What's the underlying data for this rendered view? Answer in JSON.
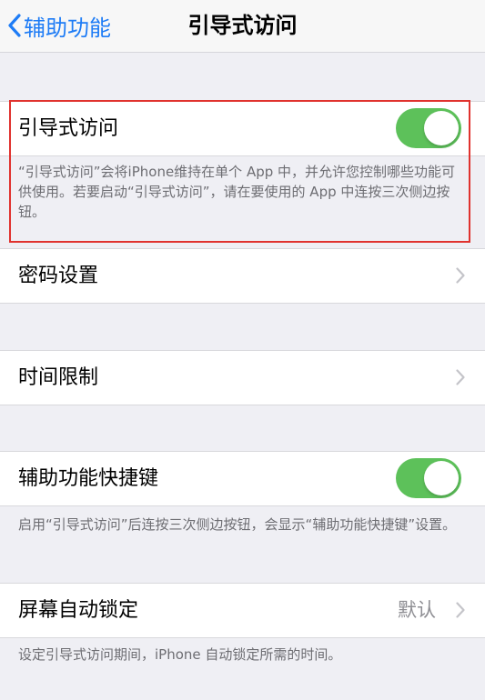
{
  "nav": {
    "back_label": "辅助功能",
    "title": "引导式访问"
  },
  "guided_access": {
    "label": "引导式访问",
    "enabled": true,
    "description": "“引导式访问”会将iPhone维持在单个 App 中，并允许您控制哪些功能可供使用。若要启动“引导式访问”，请在要使用的 App 中连按三次侧边按钮。"
  },
  "passcode": {
    "label": "密码设置"
  },
  "time_limits": {
    "label": "时间限制"
  },
  "accessibility_shortcut": {
    "label": "辅助功能快捷键",
    "enabled": true,
    "description": "启用“引导式访问”后连按三次侧边按钮，会显示“辅助功能快捷键”设置。"
  },
  "auto_lock": {
    "label": "屏幕自动锁定",
    "value": "默认",
    "description": "设定引导式访问期间，iPhone 自动锁定所需的时间。"
  },
  "colors": {
    "accent": "#1e7cf6",
    "toggle_on": "#5dc15a",
    "highlight": "#e0322e",
    "group_background": "#efeff4",
    "secondary_text": "#6d6d72"
  }
}
